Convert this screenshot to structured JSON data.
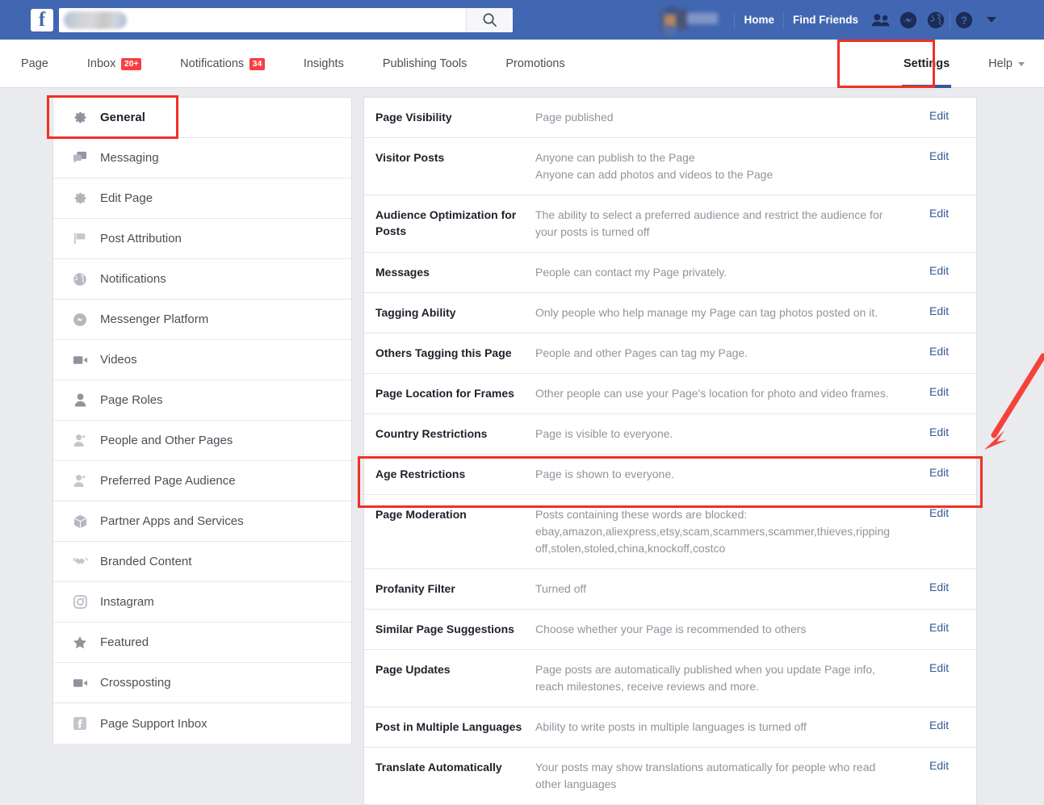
{
  "topbar": {
    "logo": "f",
    "search_placeholder": "",
    "search_value": "",
    "search_icon": "search-icon",
    "links": [
      "Home",
      "Find Friends"
    ],
    "icons": [
      "friend-requests-icon",
      "messenger-icon",
      "globe-notifications-icon",
      "help-icon",
      "account-dropdown-caret"
    ]
  },
  "tabs": [
    {
      "label": "Page",
      "badge": "",
      "active": false
    },
    {
      "label": "Inbox",
      "badge": "20+",
      "active": false
    },
    {
      "label": "Notifications",
      "badge": "34",
      "active": false
    },
    {
      "label": "Insights",
      "badge": "",
      "active": false
    },
    {
      "label": "Publishing Tools",
      "badge": "",
      "active": false
    },
    {
      "label": "Promotions",
      "badge": "",
      "active": false
    },
    {
      "label": "Settings",
      "badge": "",
      "active": true
    }
  ],
  "help_tab": {
    "label": "Help"
  },
  "sidebar": {
    "items": [
      {
        "label": "General",
        "icon": "gear-icon",
        "selected": true
      },
      {
        "label": "Messaging",
        "icon": "chat-bubbles-icon",
        "selected": false
      },
      {
        "label": "Edit Page",
        "icon": "gear-icon",
        "selected": false
      },
      {
        "label": "Post Attribution",
        "icon": "flag-icon",
        "selected": false
      },
      {
        "label": "Notifications",
        "icon": "globe-icon",
        "selected": false
      },
      {
        "label": "Messenger Platform",
        "icon": "messenger-icon",
        "selected": false
      },
      {
        "label": "Videos",
        "icon": "video-camera-icon",
        "selected": false
      },
      {
        "label": "Page Roles",
        "icon": "person-icon",
        "selected": false
      },
      {
        "label": "People and Other Pages",
        "icon": "person-star-icon",
        "selected": false
      },
      {
        "label": "Preferred Page Audience",
        "icon": "person-star-icon",
        "selected": false
      },
      {
        "label": "Partner Apps and Services",
        "icon": "box-icon",
        "selected": false
      },
      {
        "label": "Branded Content",
        "icon": "handshake-icon",
        "selected": false
      },
      {
        "label": "Instagram",
        "icon": "instagram-icon",
        "selected": false
      },
      {
        "label": "Featured",
        "icon": "star-icon",
        "selected": false
      },
      {
        "label": "Crossposting",
        "icon": "video-camera-icon",
        "selected": false
      },
      {
        "label": "Page Support Inbox",
        "icon": "facebook-icon",
        "selected": false
      }
    ]
  },
  "settings": {
    "edit_label": "Edit",
    "rows": [
      {
        "label": "Page Visibility",
        "lines": [
          "Page published"
        ]
      },
      {
        "label": "Visitor Posts",
        "lines": [
          "Anyone can publish to the Page",
          "Anyone can add photos and videos to the Page"
        ]
      },
      {
        "label": "Audience Optimization for Posts",
        "lines": [
          "The ability to select a preferred audience and restrict the audience for",
          "your posts is turned off"
        ]
      },
      {
        "label": "Messages",
        "lines": [
          "People can contact my Page privately."
        ]
      },
      {
        "label": "Tagging Ability",
        "lines": [
          "Only people who help manage my Page can tag photos posted on it."
        ]
      },
      {
        "label": "Others Tagging this Page",
        "lines": [
          "People and other Pages can tag my Page."
        ]
      },
      {
        "label": "Page Location for Frames",
        "lines": [
          "Other people can use your Page's location for photo and video frames."
        ]
      },
      {
        "label": "Country Restrictions",
        "lines": [
          "Page is visible to everyone."
        ]
      },
      {
        "label": "Age Restrictions",
        "lines": [
          "Page is shown to everyone."
        ]
      },
      {
        "label": "Page Moderation",
        "lines": [
          "Posts containing these words are blocked:",
          "ebay,amazon,aliexpress,etsy,scam,scammers,scammer,thieves,ripping",
          "off,stolen,stoled,china,knockoff,costco"
        ],
        "highlighted": true
      },
      {
        "label": "Profanity Filter",
        "lines": [
          "Turned off"
        ]
      },
      {
        "label": "Similar Page Suggestions",
        "lines": [
          "Choose whether your Page is recommended to others"
        ]
      },
      {
        "label": "Page Updates",
        "lines": [
          "Page posts are automatically published when you update Page info,",
          "reach milestones, receive reviews and more."
        ]
      },
      {
        "label": "Post in Multiple Languages",
        "lines": [
          "Ability to write posts in multiple languages is turned off"
        ]
      },
      {
        "label": "Translate Automatically",
        "lines": [
          "Your posts may show translations automatically for people who read",
          "other languages"
        ]
      }
    ]
  },
  "annotations": {
    "color": "#ef3124",
    "highlight_general": "General sidebar item highlighted",
    "highlight_settings": "Settings tab highlighted",
    "highlight_moderation": "Page Moderation row highlighted",
    "arrow": "red-arrow-pointing-to-page-moderation"
  },
  "colors": {
    "brand_blue": "#4267b2",
    "link_blue": "#365899",
    "badge_red": "#fa3e3e",
    "annotation_red": "#ef3124",
    "page_bg": "#e9ebee",
    "value_gray": "#90949c"
  }
}
